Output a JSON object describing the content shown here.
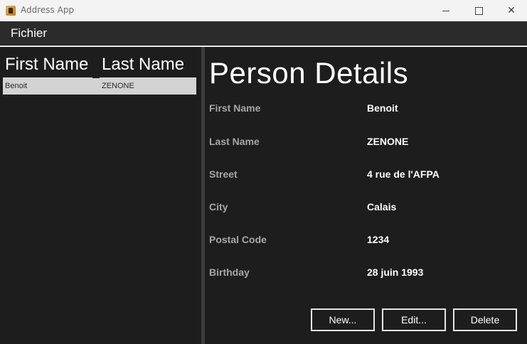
{
  "window": {
    "title": "Address App",
    "icon": "address-book-icon",
    "controls": {
      "minimize": "minimize-icon",
      "maximize": "maximize-icon",
      "close": "close-icon",
      "close_glyph": "✕"
    }
  },
  "menubar": {
    "items": [
      {
        "label": "Fichier"
      }
    ]
  },
  "table": {
    "columns": [
      "First Name",
      "Last Name"
    ],
    "rows": [
      {
        "first_name": "Benoit",
        "last_name": "ZENONE",
        "selected": true
      }
    ]
  },
  "details": {
    "title": "Person Details",
    "fields": [
      {
        "label": "First Name",
        "value": "Benoit"
      },
      {
        "label": "Last Name",
        "value": "ZENONE"
      },
      {
        "label": "Street",
        "value": "4 rue de l'AFPA"
      },
      {
        "label": "City",
        "value": "Calais"
      },
      {
        "label": "Postal Code",
        "value": "1234"
      },
      {
        "label": "Birthday",
        "value": "28 juin 1993"
      }
    ]
  },
  "buttons": {
    "new_label": "New...",
    "edit_label": "Edit...",
    "delete_label": "Delete"
  },
  "colors": {
    "background": "#1d1d1d",
    "menubar": "#2b2b2b",
    "selected_row": "#d3d3d3",
    "label": "#a7a7a7",
    "value": "#ffffff"
  }
}
